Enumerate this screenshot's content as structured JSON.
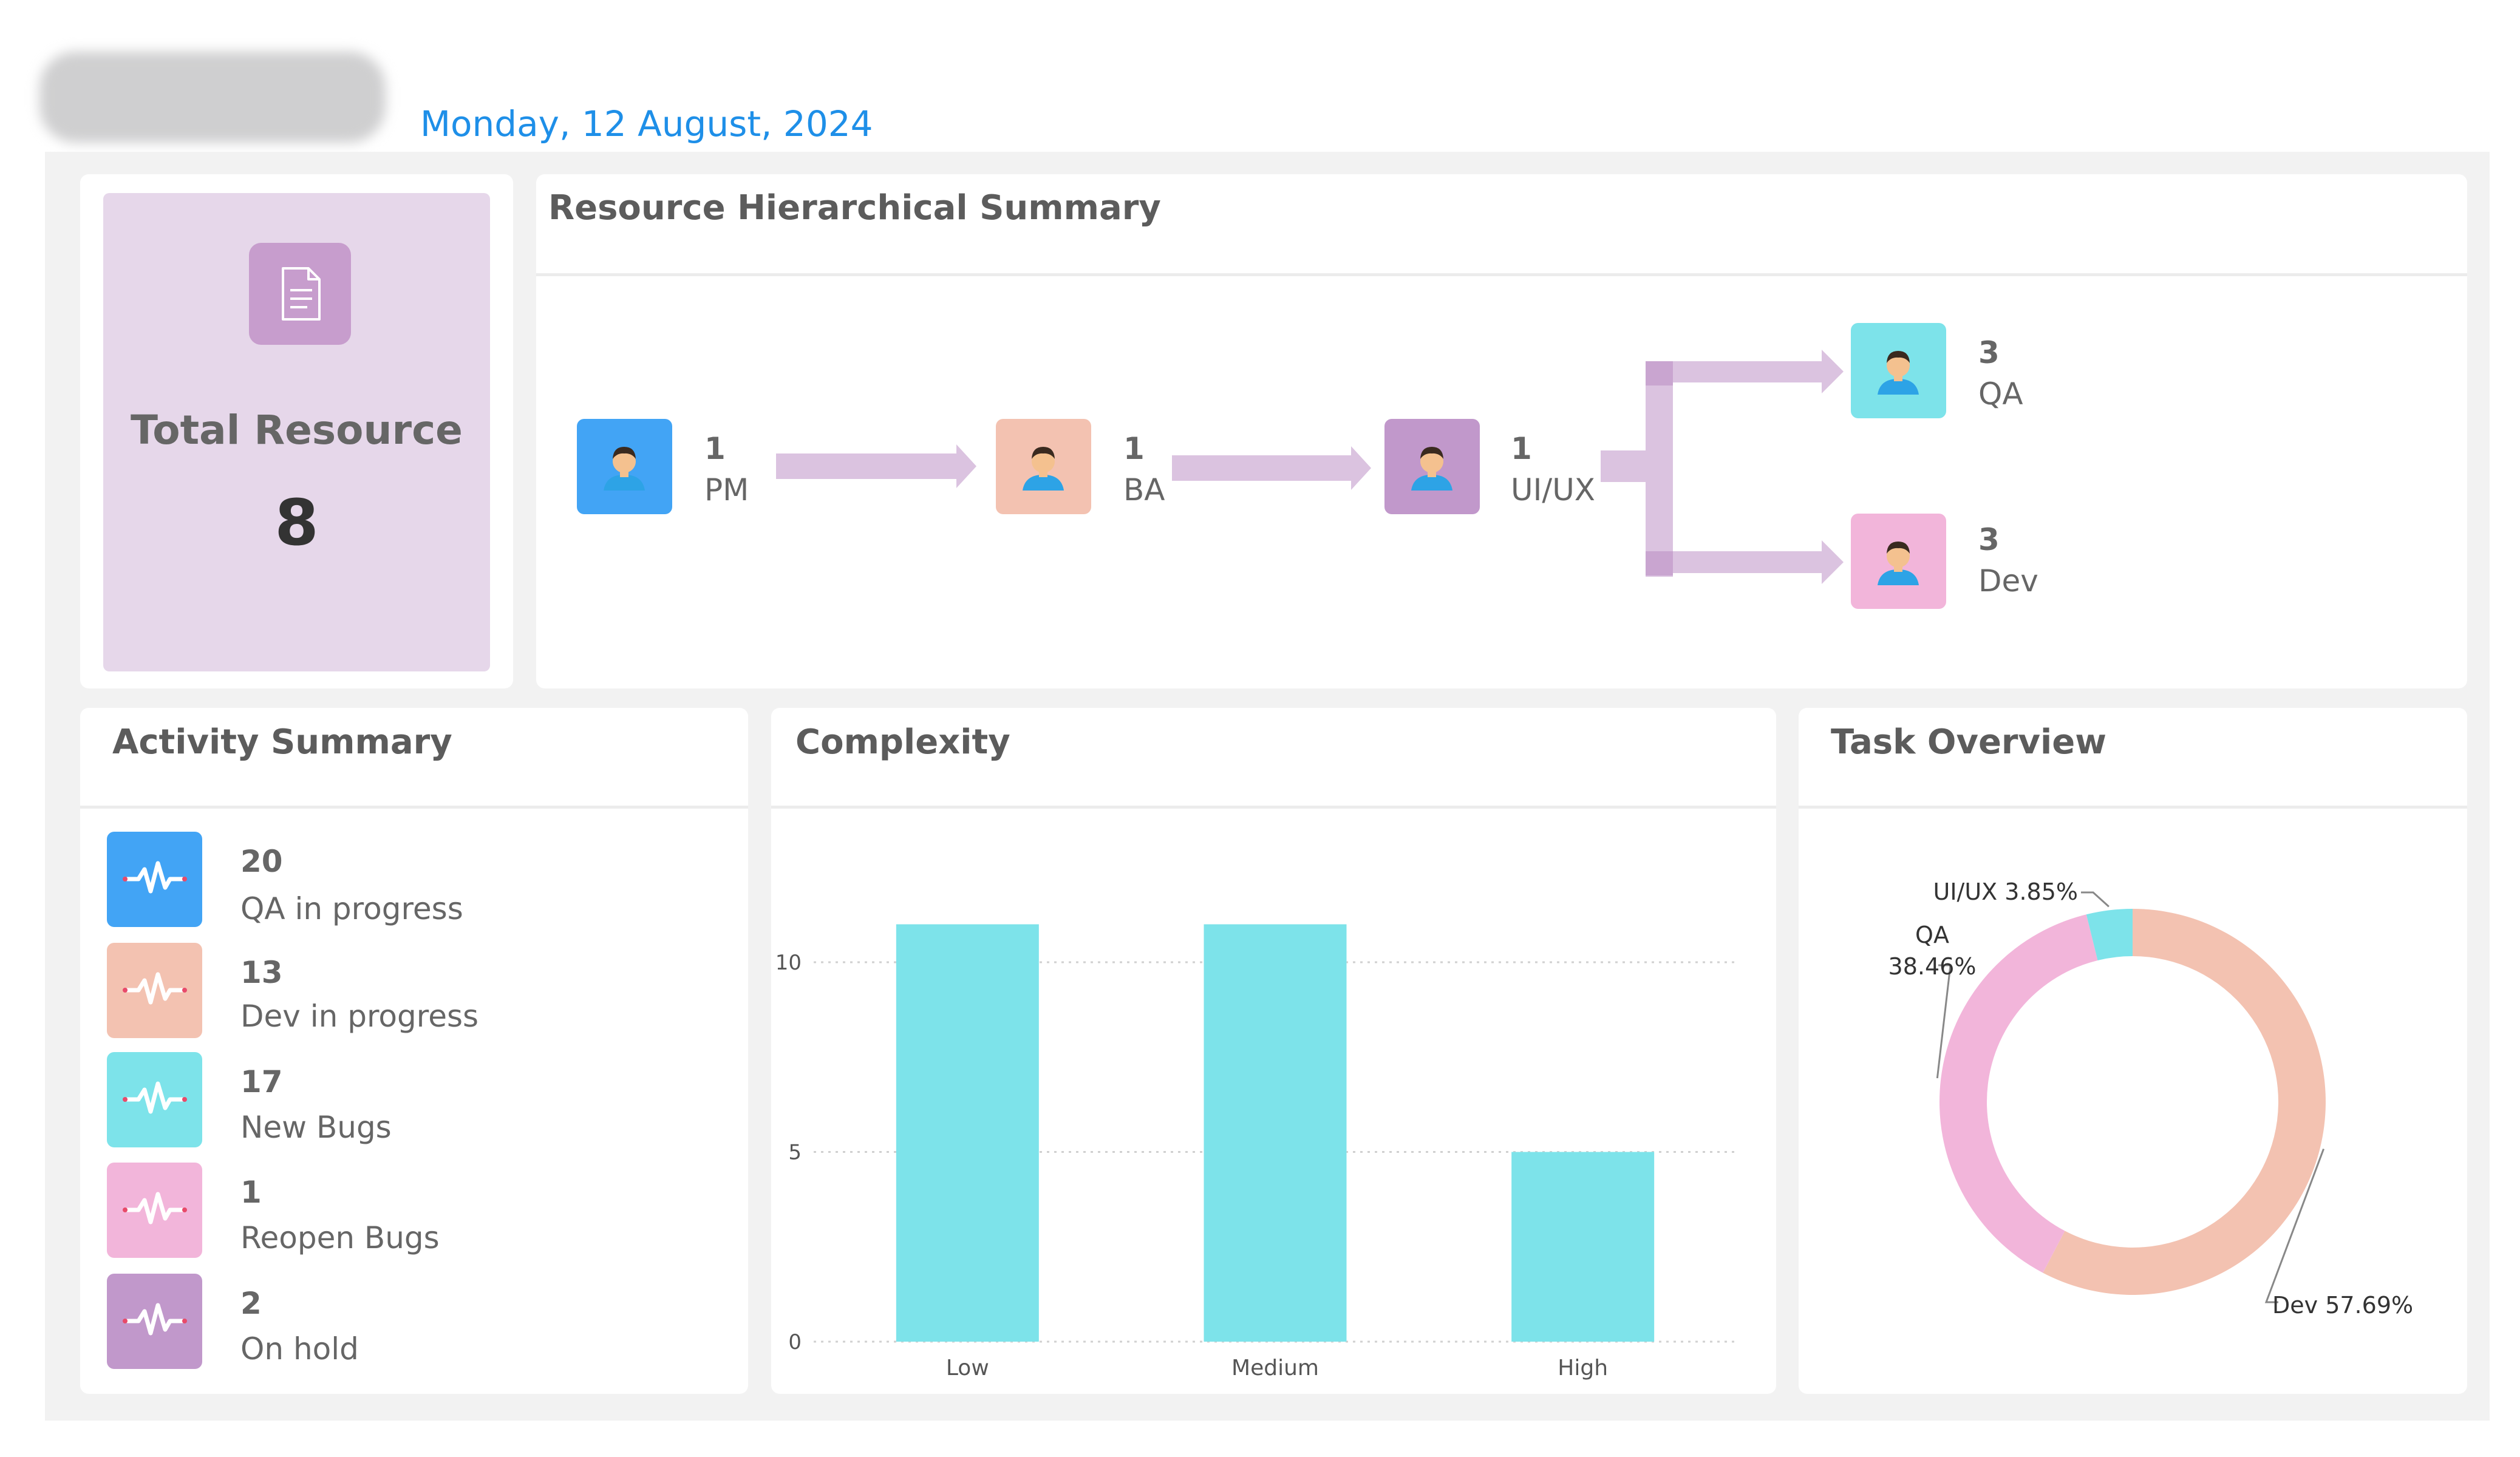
{
  "header": {
    "date": "Monday, 12 August, 2024"
  },
  "colors": {
    "pm": "#42a4f5",
    "ba": "#f3c2b1",
    "uiux": "#c198cb",
    "qa": "#7de3ea",
    "dev": "#f2b5da",
    "arrow": "#dbc3e0",
    "bar": "#7de3ea",
    "qa_in_progress": "#42a4f5",
    "dev_in_progress": "#f3c2b1",
    "new_bugs": "#7de3ea",
    "reopen_bugs": "#f2b5da",
    "on_hold": "#c198cb"
  },
  "total_resource": {
    "label": "Total Resource",
    "value": "8",
    "icon": "document-icon"
  },
  "hierarchy": {
    "title": "Resource Hierarchical Summary",
    "nodes": [
      {
        "count": "1",
        "role": "PM",
        "icon": "person-icon"
      },
      {
        "count": "1",
        "role": "BA",
        "icon": "person-icon"
      },
      {
        "count": "1",
        "role": "UI/UX",
        "icon": "person-icon"
      },
      {
        "count": "3",
        "role": "QA",
        "icon": "person-icon"
      },
      {
        "count": "3",
        "role": "Dev",
        "icon": "person-icon"
      }
    ]
  },
  "activity": {
    "title": "Activity Summary",
    "items": [
      {
        "count": "20",
        "label": "QA in progress",
        "icon": "pulse-icon"
      },
      {
        "count": "13",
        "label": "Dev in progress",
        "icon": "pulse-icon"
      },
      {
        "count": "17",
        "label": "New Bugs",
        "icon": "pulse-icon"
      },
      {
        "count": "1",
        "label": "Reopen Bugs",
        "icon": "pulse-icon"
      },
      {
        "count": "2",
        "label": "On hold",
        "icon": "pulse-icon"
      }
    ]
  },
  "complexity": {
    "title": "Complexity"
  },
  "task_overview": {
    "title": "Task Overview"
  },
  "chart_data": [
    {
      "type": "bar",
      "title": "Complexity",
      "categories": [
        "Low",
        "Medium",
        "High"
      ],
      "values": [
        11,
        11,
        5
      ],
      "yticks": [
        0,
        5,
        10
      ],
      "ylim": [
        0,
        12
      ],
      "grid": true
    },
    {
      "type": "pie",
      "title": "Task Overview",
      "donut": true,
      "slices": [
        {
          "label": "Dev",
          "value": 57.69,
          "display": "Dev 57.69%"
        },
        {
          "label": "QA",
          "value": 38.46,
          "display": "QA 38.46%"
        },
        {
          "label": "UI/UX",
          "value": 3.85,
          "display": "UI/UX 3.85%"
        }
      ]
    }
  ]
}
